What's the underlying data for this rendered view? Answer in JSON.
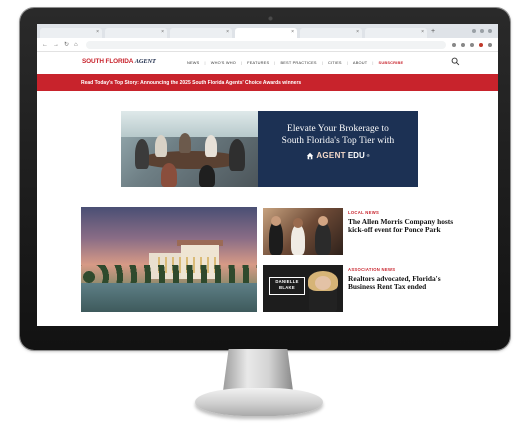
{
  "browser": {
    "tab_close_glyph": "×",
    "new_tab_glyph": "+"
  },
  "site": {
    "logo_part1": "SOUTH FLORIDA",
    "logo_part2": "AGENT",
    "nav": [
      "NEWS",
      "WHO'S WHO",
      "FEATURES",
      "BEST PRACTICES",
      "CITIES",
      "ABOUT",
      "SUBSCRIBE"
    ],
    "top_story": "Read Today's Top Story: Announcing the 2025 South Florida Agents' Choice Awards winners"
  },
  "ad": {
    "line1": "Elevate Your Brokerage to",
    "line2": "South Florida's Top Tier with",
    "brand_agent": "AGENT",
    "brand_edu": "EDU",
    "brand_reg": "®"
  },
  "stories": [
    {
      "category": "LOCAL NEWS",
      "headline": "The Allen Morris Company hosts kick-off event for Ponce Park"
    },
    {
      "category": "ASSOCIATION NEWS",
      "headline": "Realtors advocated, Florida's Business Rent Tax ended",
      "thumb_caption_line1": "DANIELLE",
      "thumb_caption_line2": "BLAKE"
    }
  ],
  "colors": {
    "brand_red": "#c8232c",
    "ad_navy": "#1c3154"
  }
}
